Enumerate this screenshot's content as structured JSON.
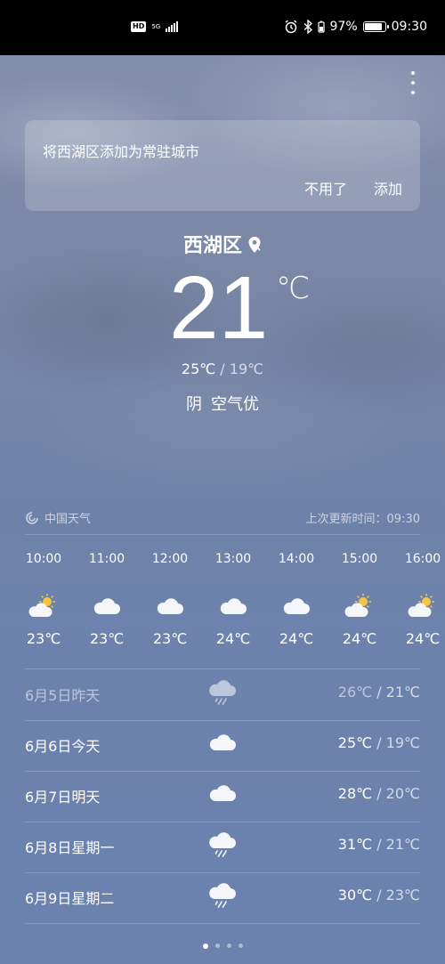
{
  "status_bar": {
    "hd": "HD",
    "net": "5G",
    "battery": "97%",
    "time": "09:30",
    "battery_level": 0.97
  },
  "banner": {
    "text": "将西湖区添加为常驻城市",
    "decline_label": "不用了",
    "add_label": "添加"
  },
  "current": {
    "location": "西湖区",
    "temp": "21",
    "unit": "℃",
    "high": "25℃",
    "sep": " / ",
    "low": "19℃",
    "condition": "阴",
    "air": "空气优"
  },
  "source": {
    "provider": "中国天气",
    "updated": "上次更新时间：09:30"
  },
  "hourly": [
    {
      "time": "10:00",
      "icon": "partly-sunny-icon",
      "temp": "23℃"
    },
    {
      "time": "11:00",
      "icon": "cloudy-icon",
      "temp": "23℃"
    },
    {
      "time": "12:00",
      "icon": "cloudy-icon",
      "temp": "23℃"
    },
    {
      "time": "13:00",
      "icon": "cloudy-icon",
      "temp": "24℃"
    },
    {
      "time": "14:00",
      "icon": "cloudy-icon",
      "temp": "24℃"
    },
    {
      "time": "15:00",
      "icon": "partly-sunny-icon",
      "temp": "24℃"
    },
    {
      "time": "16:00",
      "icon": "partly-sunny-icon",
      "temp": "24℃"
    }
  ],
  "daily": [
    {
      "date": "6月5日昨天",
      "icon": "rain-icon",
      "high": "26℃",
      "sep": " / ",
      "low": "21℃"
    },
    {
      "date": "6月6日今天",
      "icon": "cloudy-icon",
      "high": "25℃",
      "sep": " / ",
      "low": "19℃"
    },
    {
      "date": "6月7日明天",
      "icon": "cloudy-icon",
      "high": "28℃",
      "sep": " / ",
      "low": "20℃"
    },
    {
      "date": "6月8日星期一",
      "icon": "rain-icon",
      "high": "31℃",
      "sep": " / ",
      "low": "21℃"
    },
    {
      "date": "6月9日星期二",
      "icon": "rain-icon",
      "high": "30℃",
      "sep": " / ",
      "low": "23℃"
    }
  ],
  "pager": {
    "pages": 4,
    "active": 0
  }
}
